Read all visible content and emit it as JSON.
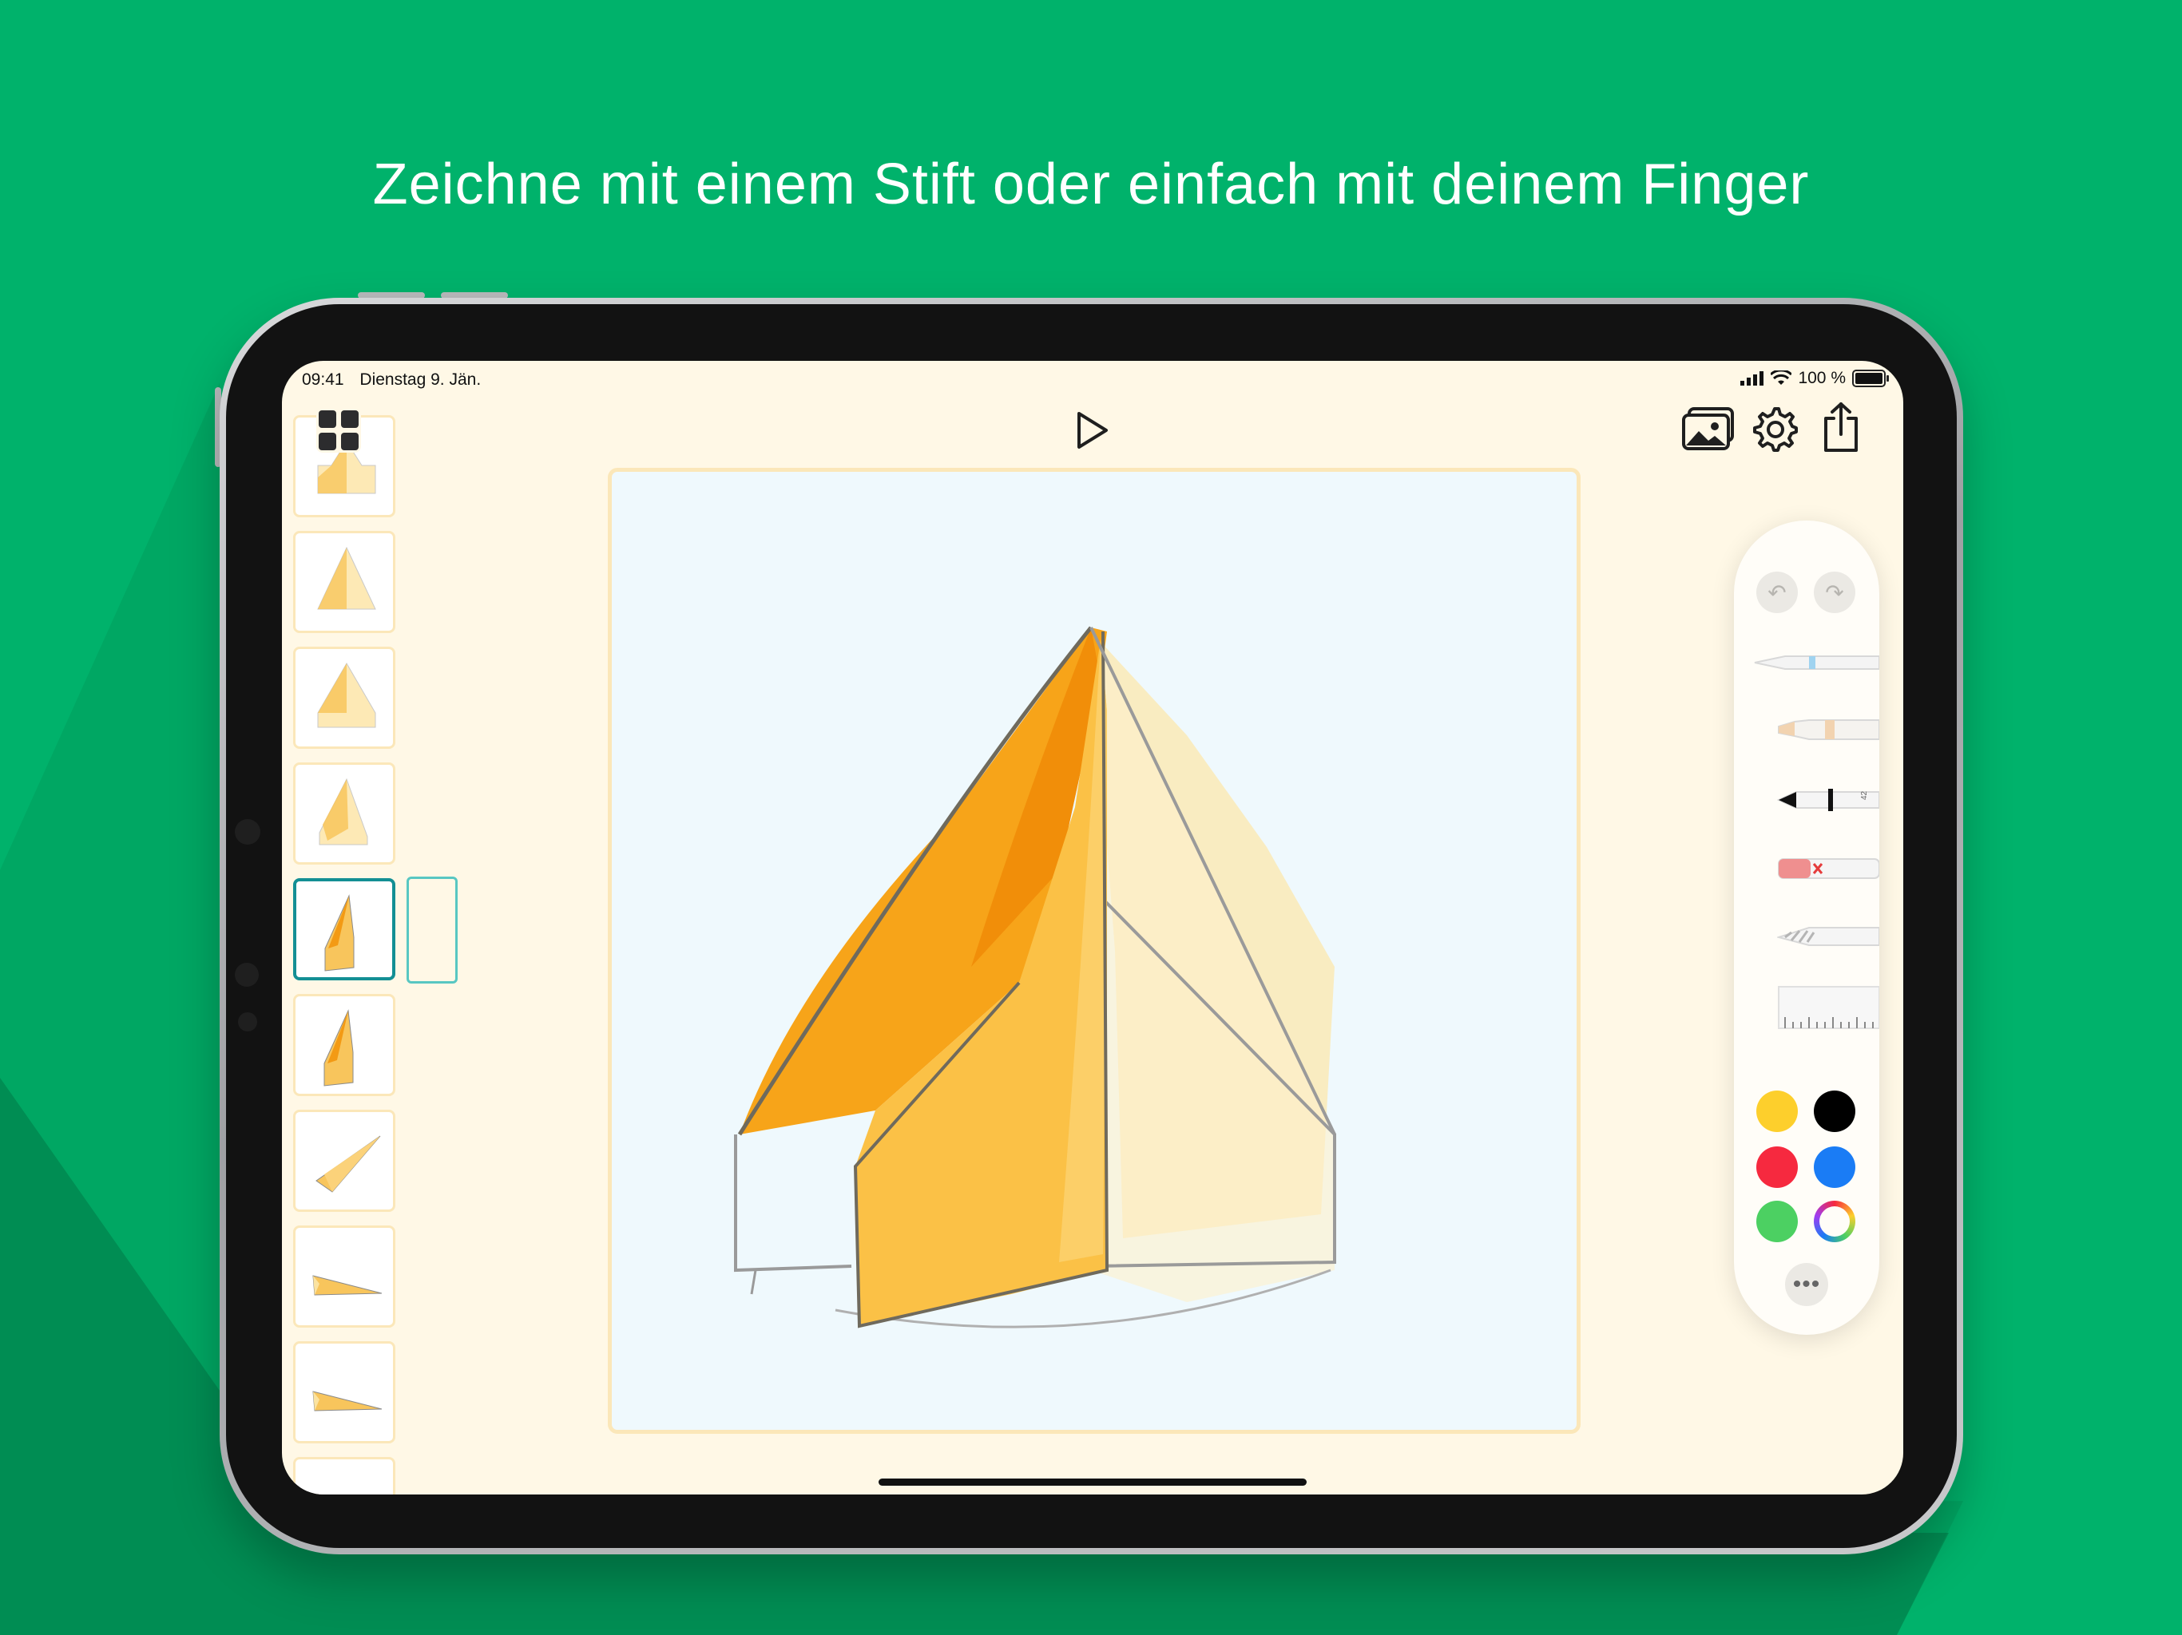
{
  "headline": "Zeichne mit einem Stift oder einfach mit deinem Finger",
  "status_bar": {
    "time": "09:41",
    "date": "Dienstag 9. Jän.",
    "battery": "100 %"
  },
  "toolbar": {
    "grid_icon": "grid-icon",
    "play_icon": "play-icon",
    "gallery_icon": "gallery-icon",
    "settings_icon": "gear-icon",
    "share_icon": "share-icon"
  },
  "frames": [
    {
      "name": "frame-1",
      "selected": false
    },
    {
      "name": "frame-2",
      "selected": false
    },
    {
      "name": "frame-3",
      "selected": false
    },
    {
      "name": "frame-4",
      "selected": false
    },
    {
      "name": "frame-5",
      "selected": true
    },
    {
      "name": "frame-6",
      "selected": false
    },
    {
      "name": "frame-7",
      "selected": false
    },
    {
      "name": "frame-8",
      "selected": false
    },
    {
      "name": "frame-9",
      "selected": false
    }
  ],
  "tools": [
    {
      "name": "fineliner",
      "icon": "pen-tool-icon"
    },
    {
      "name": "marker",
      "icon": "marker-tool-icon"
    },
    {
      "name": "pencil",
      "icon": "pencil-tool-icon",
      "label": "42"
    },
    {
      "name": "eraser",
      "icon": "eraser-tool-icon"
    },
    {
      "name": "lasso",
      "icon": "lasso-tool-icon"
    },
    {
      "name": "ruler",
      "icon": "ruler-tool-icon"
    }
  ],
  "colors": {
    "background": "#00b26b",
    "yellow": "#fdcf2c",
    "black": "#000000",
    "red": "#f6293f",
    "blue": "#1a7cf5",
    "green": "#4cd062",
    "accent_selected": "#138f94"
  }
}
